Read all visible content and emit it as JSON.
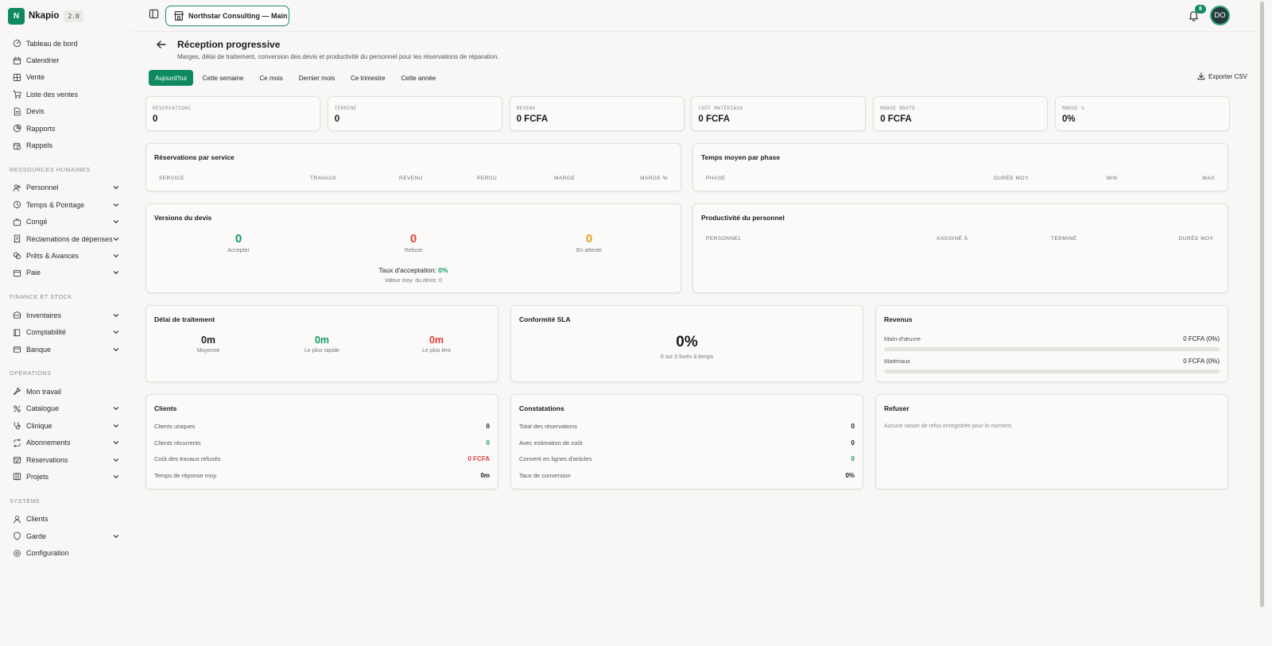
{
  "brand": {
    "initial": "N",
    "name": "Nkapio",
    "version": "2.0"
  },
  "sidebar": {
    "top_items": [
      {
        "label": "Tableau de bord",
        "icon": "dashboard-icon"
      },
      {
        "label": "Calendrier",
        "icon": "calendar-icon"
      },
      {
        "label": "Vente",
        "icon": "pos-icon"
      },
      {
        "label": "Liste des ventes",
        "icon": "cart-icon"
      },
      {
        "label": "Devis",
        "icon": "document-icon"
      },
      {
        "label": "Rapports",
        "icon": "pie-chart-icon"
      },
      {
        "label": "Rappels",
        "icon": "calendar-clock-icon"
      }
    ],
    "sections": [
      {
        "title": "RESSOURCES HUMAINES",
        "items": [
          {
            "label": "Personnel",
            "icon": "users-icon",
            "expandable": true
          },
          {
            "label": "Temps & Pointage",
            "icon": "clock-icon",
            "expandable": true
          },
          {
            "label": "Congé",
            "icon": "briefcase-icon",
            "expandable": true
          },
          {
            "label": "Réclamations de dépenses",
            "icon": "receipt-icon",
            "expandable": true
          },
          {
            "label": "Prêts & Avances",
            "icon": "coins-icon",
            "expandable": true
          },
          {
            "label": "Paie",
            "icon": "wallet-icon",
            "expandable": true
          }
        ]
      },
      {
        "title": "FINANCE ET STOCK",
        "items": [
          {
            "label": "Inventaires",
            "icon": "inventory-icon",
            "expandable": true
          },
          {
            "label": "Comptabilité",
            "icon": "book-icon",
            "expandable": true
          },
          {
            "label": "Banque",
            "icon": "bank-icon",
            "expandable": true
          }
        ]
      },
      {
        "title": "OPÉRATIONS",
        "items": [
          {
            "label": "Mon travail",
            "icon": "wrench-icon",
            "expandable": false
          },
          {
            "label": "Catalogue",
            "icon": "catalog-icon",
            "expandable": true
          },
          {
            "label": "Clinique",
            "icon": "stethoscope-icon",
            "expandable": true
          },
          {
            "label": "Abonnements",
            "icon": "repeat-icon",
            "expandable": true
          },
          {
            "label": "Réservations",
            "icon": "calendar-check-icon",
            "expandable": true
          },
          {
            "label": "Projets",
            "icon": "projects-icon",
            "expandable": true
          }
        ]
      },
      {
        "title": "SYSTÈME",
        "items": [
          {
            "label": "Clients",
            "icon": "user-icon",
            "expandable": false
          },
          {
            "label": "Garde",
            "icon": "shield-icon",
            "expandable": true
          },
          {
            "label": "Configuration",
            "icon": "gear-icon",
            "expandable": false
          }
        ]
      }
    ]
  },
  "topbar": {
    "org": "Northstar Consulting — Main",
    "notifications": "8",
    "avatar": "DO"
  },
  "page": {
    "title": "Réception progressive",
    "subtitle": "Marges, délai de traitement, conversion des devis et productivité du personnel pour les réservations de réparation.",
    "tabs": [
      "Aujourd'hui",
      "Cette semaine",
      "Ce mois",
      "Dernier mois",
      "Ce trimestre",
      "Cette année"
    ],
    "active_tab": 0,
    "export": "Exporter CSV"
  },
  "kpis": [
    {
      "label": "RÉSERVATIONS",
      "value": "0"
    },
    {
      "label": "TERMINÉ",
      "value": "0"
    },
    {
      "label": "REVENU",
      "value": "0 FCFA"
    },
    {
      "label": "COÛT MATÉRIAUX",
      "value": "0 FCFA"
    },
    {
      "label": "MARGE BRUTE",
      "value": "0 FCFA"
    },
    {
      "label": "MARGE %",
      "value": "0%"
    }
  ],
  "bookings_by_service": {
    "title": "Réservations par service",
    "columns": [
      "SERVICE",
      "TRAVAUX",
      "REVENU",
      "PERDU",
      "MARGE",
      "MARGE %"
    ]
  },
  "avg_phase_time": {
    "title": "Temps moyen par phase",
    "columns": [
      "PHASE",
      "DURÉE MOY.",
      "MIN",
      "MAX"
    ]
  },
  "quote_versions": {
    "title": "Versions du devis",
    "accepted": {
      "value": "0",
      "label": "Accepter"
    },
    "refused": {
      "value": "0",
      "label": "Refusé"
    },
    "pending": {
      "value": "0",
      "label": "En attente"
    },
    "acceptance_label": "Taux d'acceptation:",
    "acceptance_value": "0%",
    "avg_value": "Valeur moy. du devis: 0"
  },
  "staff_productivity": {
    "title": "Productivité du personnel",
    "columns": [
      "PERSONNEL",
      "ASSIGNÉ À",
      "TERMINÉ",
      "DURÉE MOY."
    ]
  },
  "turnaround": {
    "title": "Délai de traitement",
    "avg": {
      "value": "0m",
      "label": "Moyenne"
    },
    "fastest": {
      "value": "0m",
      "label": "Le plus rapide"
    },
    "slowest": {
      "value": "0m",
      "label": "Le plus lent"
    }
  },
  "sla": {
    "title": "Conformité SLA",
    "value": "0%",
    "detail": "0 sur 0 livrés à temps"
  },
  "revenue": {
    "title": "Revenus",
    "rows": [
      {
        "label": "Main-d'œuvre",
        "value": "0 FCFA (0%)",
        "fraction": 0
      },
      {
        "label": "Matériaux",
        "value": "0 FCFA (0%)",
        "fraction": 0
      }
    ]
  },
  "clients": {
    "title": "Clients",
    "rows": [
      {
        "label": "Clients uniques",
        "value": "0",
        "color": "#1a1a1a"
      },
      {
        "label": "Clients récurrents",
        "value": "0",
        "color": "#0f9a63"
      },
      {
        "label": "Coût des travaux refusés",
        "value": "0 FCFA",
        "color": "#e03e3e"
      },
      {
        "label": "Temps de réponse moy.",
        "value": "0m",
        "color": "#1a1a1a"
      }
    ]
  },
  "findings": {
    "title": "Constatations",
    "rows": [
      {
        "label": "Total des réservations",
        "value": "0",
        "color": "#1a1a1a"
      },
      {
        "label": "Avec estimation de coût",
        "value": "0",
        "color": "#1a1a1a"
      },
      {
        "label": "Converti en lignes d'articles",
        "value": "0",
        "color": "#0f9a63"
      },
      {
        "label": "Taux de conversion",
        "value": "0%",
        "color": "#1a1a1a"
      }
    ]
  },
  "refuse": {
    "title": "Refuser",
    "empty": "Aucune raison de refus enregistrée pour le moment."
  },
  "colors": {
    "accent": "#0f8a5f",
    "green": "#0f9a63",
    "red": "#e03e3e",
    "amber": "#e0a31a"
  }
}
